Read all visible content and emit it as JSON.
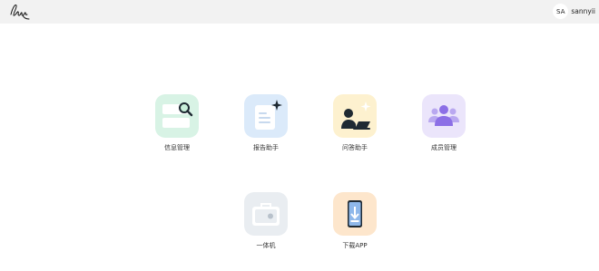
{
  "header": {
    "logo_icon": "signature-logo-icon",
    "user": {
      "initials": "SA",
      "name": "sannyii"
    }
  },
  "apps": [
    {
      "label": "信息管理",
      "icon": "info-management-icon",
      "color": "#d8f3e5"
    },
    {
      "label": "报告助手",
      "icon": "report-assistant-icon",
      "color": "#dbeafa"
    },
    {
      "label": "问答助手",
      "icon": "qa-assistant-icon",
      "color": "#fdf1cf"
    },
    {
      "label": "成员管理",
      "icon": "member-management-icon",
      "color": "#ebe5fb"
    },
    {
      "label": "一体机",
      "icon": "all-in-one-machine-icon",
      "color": "#e9edf1"
    },
    {
      "label": "下载APP",
      "icon": "download-app-icon",
      "color": "#fde6cc"
    }
  ]
}
